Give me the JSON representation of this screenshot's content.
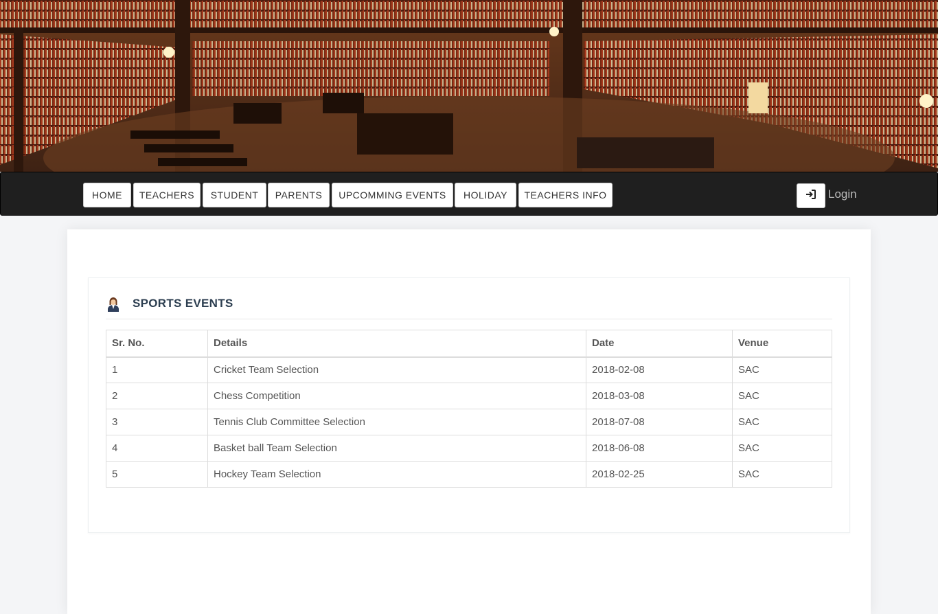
{
  "nav": {
    "items": [
      "HOME",
      "TEACHERS",
      "STUDENT",
      "PARENTS",
      "UPCOMMING EVENTS",
      "HOLIDAY",
      "TEACHERS INFO"
    ],
    "login_label": "Login"
  },
  "icons": {
    "login": "sign-in-icon",
    "panel": "person-icon"
  },
  "panel": {
    "title": "SPORTS EVENTS"
  },
  "table": {
    "headers": [
      "Sr. No.",
      "Details",
      "Date",
      "Venue"
    ],
    "rows": [
      [
        "1",
        "Cricket Team Selection",
        "2018-02-08",
        "SAC"
      ],
      [
        "2",
        "Chess Competition",
        "2018-03-08",
        "SAC"
      ],
      [
        "3",
        "Tennis Club Committee Selection",
        "2018-07-08",
        "SAC"
      ],
      [
        "4",
        "Basket ball Team Selection",
        "2018-06-08",
        "SAC"
      ],
      [
        "5",
        "Hockey Team Selection",
        "2018-02-25",
        "SAC"
      ]
    ]
  },
  "colors": {
    "navbar": "#1f1f1f",
    "page_bg": "#f4f5f7",
    "title": "#2c3e50"
  }
}
